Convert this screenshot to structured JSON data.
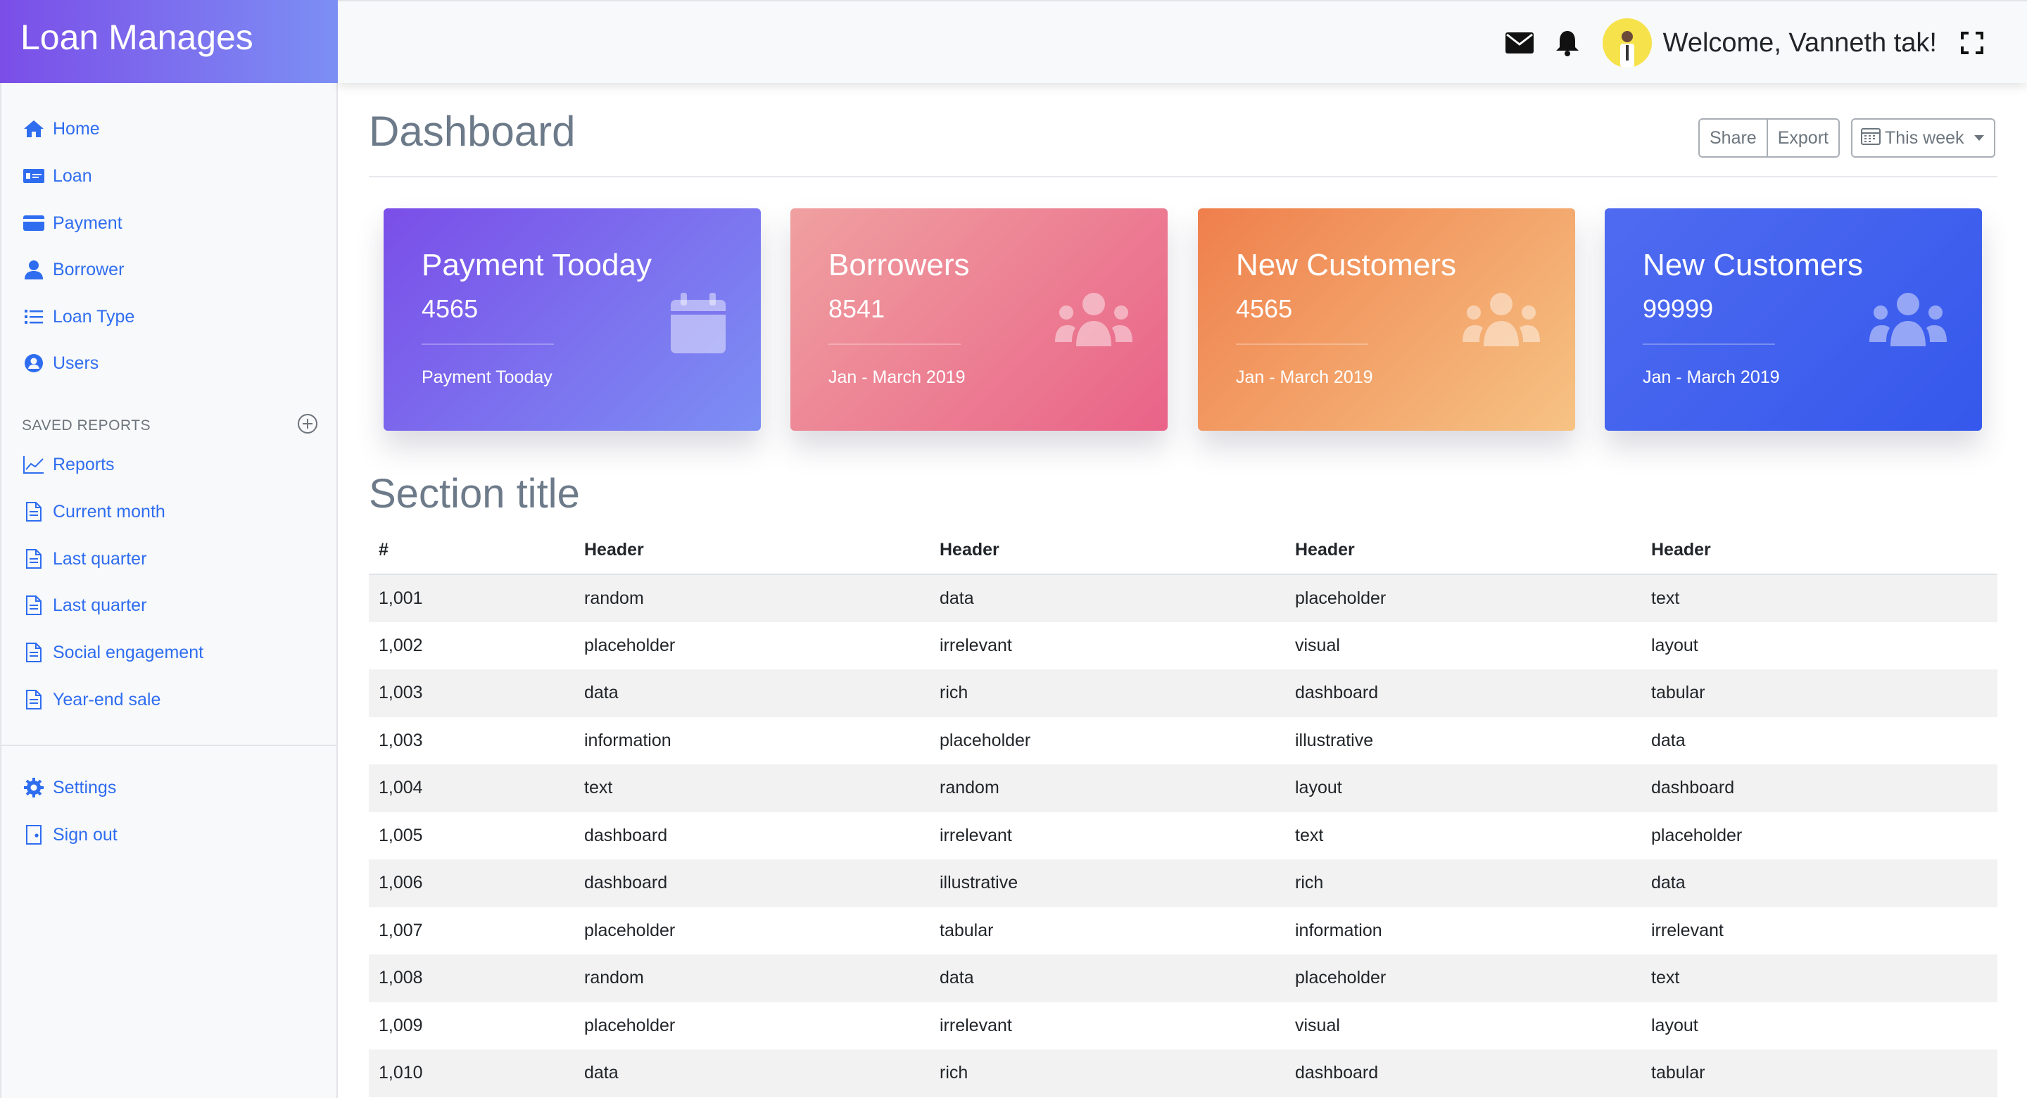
{
  "brand": {
    "title": "Loan Manages"
  },
  "topbar": {
    "welcome": "Welcome, Vanneth tak!"
  },
  "sidebar": {
    "items": [
      {
        "label": "Home",
        "icon": "home-icon"
      },
      {
        "label": "Loan",
        "icon": "money-icon"
      },
      {
        "label": "Payment",
        "icon": "credit-card-icon"
      },
      {
        "label": "Borrower",
        "icon": "user-icon"
      },
      {
        "label": "Loan Type",
        "icon": "list-icon"
      },
      {
        "label": "Users",
        "icon": "user-circle-icon"
      }
    ],
    "saved_heading": "SAVED REPORTS",
    "reports": [
      {
        "label": "Reports",
        "icon": "line-chart-icon"
      },
      {
        "label": "Current month",
        "icon": "file-icon"
      },
      {
        "label": "Last quarter",
        "icon": "file-icon"
      },
      {
        "label": "Last quarter",
        "icon": "file-icon"
      },
      {
        "label": "Social engagement",
        "icon": "file-icon"
      },
      {
        "label": "Year-end sale",
        "icon": "file-icon"
      }
    ],
    "bottom": [
      {
        "label": "Settings",
        "icon": "gear-icon"
      },
      {
        "label": "Sign out",
        "icon": "door-icon"
      }
    ]
  },
  "main": {
    "title": "Dashboard",
    "share_label": "Share",
    "export_label": "Export",
    "range_label": "This week",
    "section_title": "Section title"
  },
  "cards": [
    {
      "title": "Payment Tooday",
      "value": "4565",
      "footer": "Payment Tooday",
      "icon": "calendar-icon",
      "colors": [
        "#7b4ee8",
        "#7c8ff4"
      ]
    },
    {
      "title": "Borrowers",
      "value": "8541",
      "footer": "Jan - March 2019",
      "icon": "users-icon",
      "colors": [
        "#f0a0a0",
        "#e96388"
      ]
    },
    {
      "title": "New Customers",
      "value": "4565",
      "footer": "Jan - March 2019",
      "icon": "users-icon",
      "colors": [
        "#ef7f4c",
        "#f6c384"
      ]
    },
    {
      "title": "New Customers",
      "value": "99999",
      "footer": "Jan - March 2019",
      "icon": "users-icon",
      "colors": [
        "#4f6bf0",
        "#3558ec"
      ]
    }
  ],
  "table": {
    "headers": [
      "#",
      "Header",
      "Header",
      "Header",
      "Header"
    ],
    "rows": [
      [
        "1,001",
        "random",
        "data",
        "placeholder",
        "text"
      ],
      [
        "1,002",
        "placeholder",
        "irrelevant",
        "visual",
        "layout"
      ],
      [
        "1,003",
        "data",
        "rich",
        "dashboard",
        "tabular"
      ],
      [
        "1,003",
        "information",
        "placeholder",
        "illustrative",
        "data"
      ],
      [
        "1,004",
        "text",
        "random",
        "layout",
        "dashboard"
      ],
      [
        "1,005",
        "dashboard",
        "irrelevant",
        "text",
        "placeholder"
      ],
      [
        "1,006",
        "dashboard",
        "illustrative",
        "rich",
        "data"
      ],
      [
        "1,007",
        "placeholder",
        "tabular",
        "information",
        "irrelevant"
      ],
      [
        "1,008",
        "random",
        "data",
        "placeholder",
        "text"
      ],
      [
        "1,009",
        "placeholder",
        "irrelevant",
        "visual",
        "layout"
      ],
      [
        "1,010",
        "data",
        "rich",
        "dashboard",
        "tabular"
      ]
    ]
  },
  "colors": {
    "accent": "#2f6df0",
    "title_gray": "#6c7a89"
  }
}
